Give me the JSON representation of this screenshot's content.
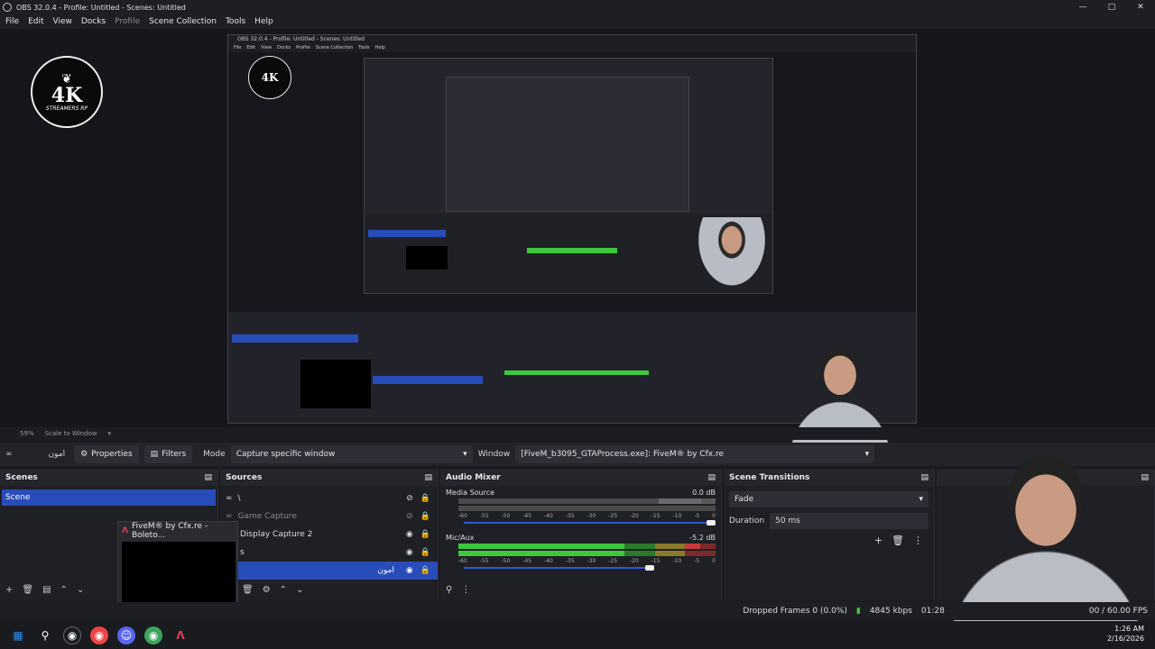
{
  "window": {
    "title": "OBS 32.0.4 - Profile: Untitled - Scenes: Untitled"
  },
  "menu": {
    "file": "File",
    "edit": "Edit",
    "view": "View",
    "docks": "Docks",
    "profile": "Profile",
    "scene_collection": "Scene Collection",
    "tools": "Tools",
    "help": "Help"
  },
  "logo": {
    "text": "4K",
    "sub": "STREAMERS RP"
  },
  "viewbar": {
    "zoom": "59%",
    "scale": "Scale to Window"
  },
  "toolbar": {
    "source_name": "امون",
    "properties_label": "Properties",
    "filters_label": "Filters",
    "mode_label": "Mode",
    "mode_value": "Capture specific window",
    "window_label": "Window",
    "window_value": "[FiveM_b3095_GTAProcess.exe]: FiveM® by Cfx.re"
  },
  "scenes": {
    "title": "Scenes",
    "items": [
      "Scene"
    ]
  },
  "sources": {
    "title": "Sources",
    "items": [
      {
        "label": "\\"
      },
      {
        "label": "Game Capture"
      },
      {
        "label": "Display Capture 2"
      },
      {
        "label": "s"
      },
      {
        "label": "امون"
      }
    ]
  },
  "popup": {
    "title": "FiveM® by Cfx.re - Boleto..."
  },
  "mixer": {
    "title": "Audio Mixer",
    "channels": [
      {
        "name": "Media Source",
        "db": "0.0 dB",
        "level": 0.0
      },
      {
        "name": "Mic/Aux",
        "db": "-5.2 dB",
        "level": 0.86
      }
    ],
    "scale": [
      "-60",
      "-55",
      "-50",
      "-45",
      "-40",
      "-35",
      "-30",
      "-25",
      "-20",
      "-15",
      "-10",
      "-5",
      "0"
    ]
  },
  "transitions": {
    "title": "Scene Transitions",
    "type": "Fade",
    "duration_label": "Duration",
    "duration_value": "50 ms"
  },
  "status": {
    "dropped": "Dropped Frames 0 (0.0%)",
    "bitrate": "4845 kbps",
    "rec_time": "01:28",
    "fps": "00 / 60.00 FPS"
  },
  "clock": {
    "time": "1:26 AM",
    "date": "2/16/2026"
  },
  "colors": {
    "accent": "#284cb8",
    "meter_green": "#3ec83e",
    "meter_yellow": "#c8b23a",
    "meter_red": "#c83a3a"
  }
}
